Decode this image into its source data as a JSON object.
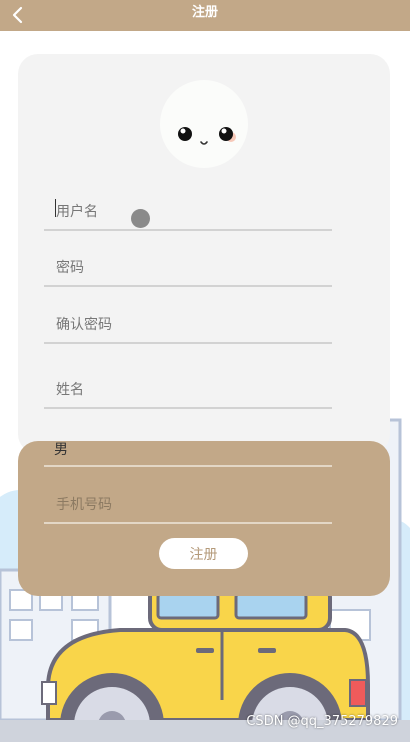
{
  "header": {
    "title": "注册",
    "back_icon": "chevron-left-icon"
  },
  "form": {
    "username_placeholder": "用户名",
    "password_placeholder": "密码",
    "confirm_password_placeholder": "确认密码",
    "name_placeholder": "姓名",
    "gender_value": "男",
    "phone_placeholder": "手机号码",
    "submit_label": "注册"
  },
  "watermark": "CSDN @qq_375279829",
  "colors": {
    "accent": "#c2a888",
    "card": "#f3f3f3",
    "car_body": "#f9d54a"
  }
}
